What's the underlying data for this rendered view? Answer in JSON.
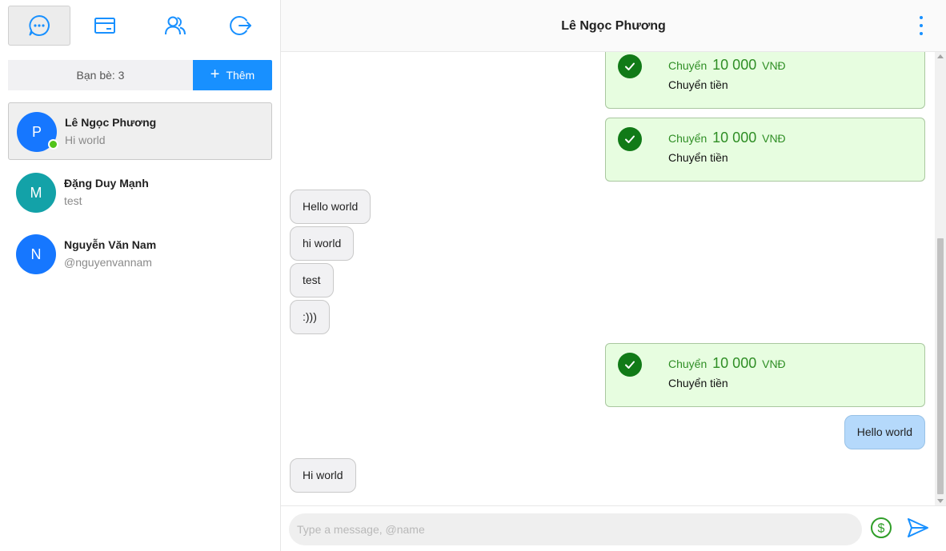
{
  "sidebar": {
    "nav": [
      {
        "icon": "chat-icon",
        "active": true
      },
      {
        "icon": "card-icon",
        "active": false
      },
      {
        "icon": "contacts-icon",
        "active": false
      },
      {
        "icon": "logout-icon",
        "active": false
      }
    ],
    "friend_count_label": "Bạn bè: 3",
    "add_label": "Thêm",
    "contacts": [
      {
        "initial": "P",
        "name": "Lê Ngọc Phương",
        "subtitle": "Hi world",
        "color": "#1677ff",
        "online": true,
        "active": true
      },
      {
        "initial": "M",
        "name": "Đặng Duy Mạnh",
        "subtitle": "test",
        "color": "#13a2a8",
        "online": false,
        "active": false
      },
      {
        "initial": "N",
        "name": "Nguyễn Văn Nam",
        "subtitle": "@nguyenvannam",
        "color": "#1677ff",
        "online": false,
        "active": false
      }
    ]
  },
  "chat": {
    "title": "Lê Ngọc Phương",
    "messages": [
      {
        "type": "transfer",
        "prefix": "Chuyển",
        "amount": "10 000",
        "currency": "VNĐ",
        "note": "Chuyển tiền"
      },
      {
        "type": "transfer",
        "prefix": "Chuyển",
        "amount": "10 000",
        "currency": "VNĐ",
        "note": "Chuyển tiền"
      },
      {
        "type": "in",
        "text": "Hello world"
      },
      {
        "type": "in",
        "text": "hi world"
      },
      {
        "type": "in",
        "text": "test"
      },
      {
        "type": "in",
        "text": ":)))"
      },
      {
        "type": "transfer",
        "prefix": "Chuyển",
        "amount": "10 000",
        "currency": "VNĐ",
        "note": "Chuyển tiền"
      },
      {
        "type": "out",
        "text": "Hello world"
      },
      {
        "type": "in",
        "text": "Hi world"
      }
    ],
    "input_placeholder": "Type a message, @name",
    "input_value": ""
  },
  "colors": {
    "accent": "#1890ff",
    "transfer_bg": "#e7fde0",
    "transfer_text": "#2f8e25",
    "check": "#117a17",
    "outgoing_bubble": "#b5d9fb"
  }
}
